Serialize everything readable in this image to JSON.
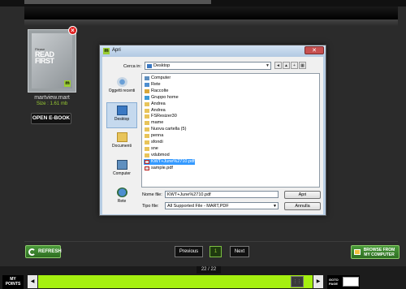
{
  "book": {
    "cover_small_text": "Please",
    "cover_read": "READ",
    "cover_first": "FIRST",
    "file_name": "martview.mart",
    "file_size": "Size : 1.61 mb",
    "open_label": "OPEN E-BOOK",
    "remove_glyph": "×",
    "logo_glyph": "m"
  },
  "dialog": {
    "title": "Apri",
    "close_glyph": "✕",
    "look_in_label": "Cerca in:",
    "look_in_value": "Desktop",
    "places": [
      {
        "label": "Oggetti recenti"
      },
      {
        "label": "Desktop"
      },
      {
        "label": "Documenti"
      },
      {
        "label": "Computer"
      },
      {
        "label": "Rete"
      }
    ],
    "files": [
      {
        "name": "Computer",
        "icon": "computer-icon"
      },
      {
        "name": "Rete",
        "icon": "network-icon"
      },
      {
        "name": "Raccolte",
        "icon": "library-icon"
      },
      {
        "name": "Gruppo home",
        "icon": "homegroup-icon"
      },
      {
        "name": "Andrea",
        "icon": "folder-icon"
      },
      {
        "name": "Andrea",
        "icon": "folder-icon"
      },
      {
        "name": "FSResizer30",
        "icon": "folder-icon"
      },
      {
        "name": "mame",
        "icon": "folder-icon"
      },
      {
        "name": "Nuova cartella (5)",
        "icon": "folder-icon"
      },
      {
        "name": "penna",
        "icon": "folder-icon"
      },
      {
        "name": "sfondi",
        "icon": "folder-icon"
      },
      {
        "name": "sne",
        "icon": "folder-icon"
      },
      {
        "name": "vdubmod",
        "icon": "folder-icon"
      },
      {
        "name": "KWT+June%2710.pdf",
        "icon": "pdf-icon",
        "selected": true
      },
      {
        "name": "sample.pdf",
        "icon": "pdf-icon"
      }
    ],
    "file_name_label": "Nome file:",
    "file_name_value": "KWT+June%2710.pdf",
    "file_type_label": "Tipo file:",
    "file_type_value": "All Supported File - MART,PDF",
    "open_button": "Apri",
    "cancel_button": "Annulla"
  },
  "controls": {
    "refresh_label": "REFRESH",
    "previous_label": "Previous",
    "page_number": "1",
    "next_label": "Next",
    "browse_line1": "BROWSE FROM",
    "browse_line2": "MY COMPUTER"
  },
  "bottom": {
    "page_count": "22 / 22",
    "my_points_line1": "MY",
    "my_points_line2": "POINTS",
    "left_arrow": "◀",
    "right_arrow": "▶",
    "handle_glyph": "⋮⋮",
    "progress_fraction": 1.0,
    "goto_line1": "GOTO",
    "goto_line2": "PAGE"
  },
  "colors": {
    "accent_green": "#9acd32",
    "progress_fill": "#a5f010",
    "selection_blue": "#3399ff"
  }
}
